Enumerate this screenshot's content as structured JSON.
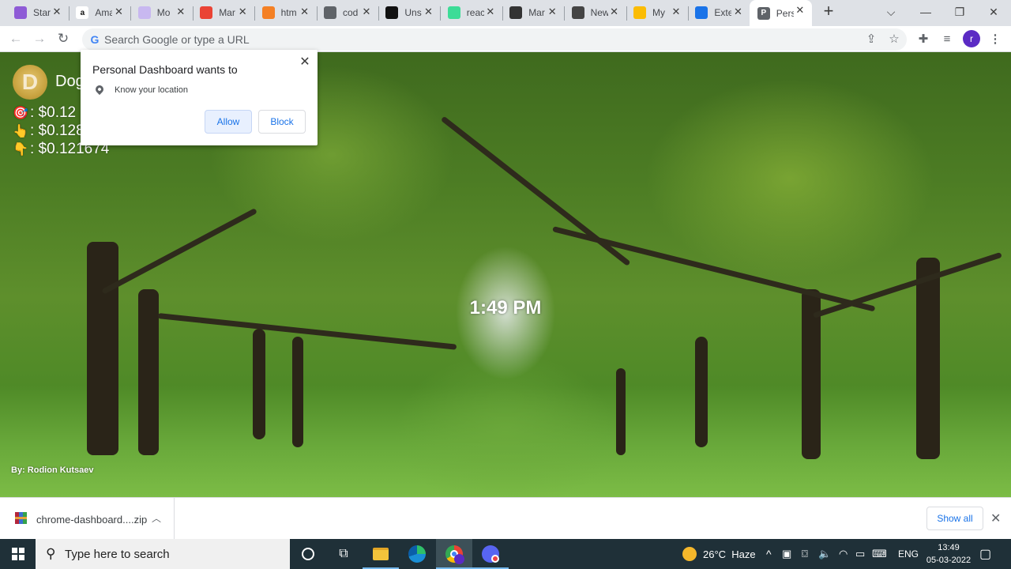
{
  "browser": {
    "tabs": [
      {
        "title": "Star",
        "favicon": "purple-circle-icon",
        "color": "#8e5bd6",
        "active": false
      },
      {
        "title": "Amazon",
        "favicon": "amazon-icon",
        "color": "#ffffff",
        "active": false
      },
      {
        "title": "Mo",
        "favicon": "mo-icon",
        "color": "#c8b8f0",
        "active": false
      },
      {
        "title": "Mar",
        "favicon": "chrome-icon",
        "color": "#ea4335",
        "active": false
      },
      {
        "title": "htm",
        "favicon": "stackoverflow-icon",
        "color": "#f48024",
        "active": false
      },
      {
        "title": "cod",
        "favicon": "globe-icon",
        "color": "#5f6368",
        "active": false
      },
      {
        "title": "Uns",
        "favicon": "unsplash-icon",
        "color": "#111111",
        "active": false
      },
      {
        "title": "reac",
        "favicon": "hash-icon",
        "color": "#3ddc97",
        "active": false
      },
      {
        "title": "Mar",
        "favicon": "markdown-icon",
        "color": "#333333",
        "active": false
      },
      {
        "title": "New",
        "favicon": "chrome-gray-icon",
        "color": "#444444",
        "active": false
      },
      {
        "title": "My",
        "favicon": "drive-icon",
        "color": "#fbbc04",
        "active": false
      },
      {
        "title": "Exte",
        "favicon": "puzzle-icon",
        "color": "#1a73e8",
        "active": false
      },
      {
        "title": "Pers",
        "favicon": "p-icon",
        "color": "#5f6368",
        "active": true
      }
    ],
    "new_tab_label": "+",
    "omnibox_placeholder": "Search Google or type a URL",
    "profile_initial": "r"
  },
  "permission_popup": {
    "title": "Personal Dashboard wants to",
    "request": "Know your location",
    "allow_label": "Allow",
    "block_label": "Block"
  },
  "dashboard": {
    "coin_name": "Dogecoin",
    "coin_logo_letter": "D",
    "prices": [
      {
        "icon": "target-icon",
        "emoji": "🎯",
        "label": ": $0.12"
      },
      {
        "icon": "pointing-up-icon",
        "emoji": "👆",
        "label": ": $0.128"
      },
      {
        "icon": "pointing-down-icon",
        "emoji": "👇",
        "label": ": $0.121674"
      }
    ],
    "time": "1:49 PM",
    "author": "By: Rodion Kutsaev"
  },
  "download_bar": {
    "file_name": "chrome-dashboard....zip",
    "show_all_label": "Show all"
  },
  "taskbar": {
    "search_placeholder": "Type here to search",
    "weather": "26°C  Haze",
    "language": "ENG",
    "time": "13:49",
    "date": "05-03-2022"
  }
}
